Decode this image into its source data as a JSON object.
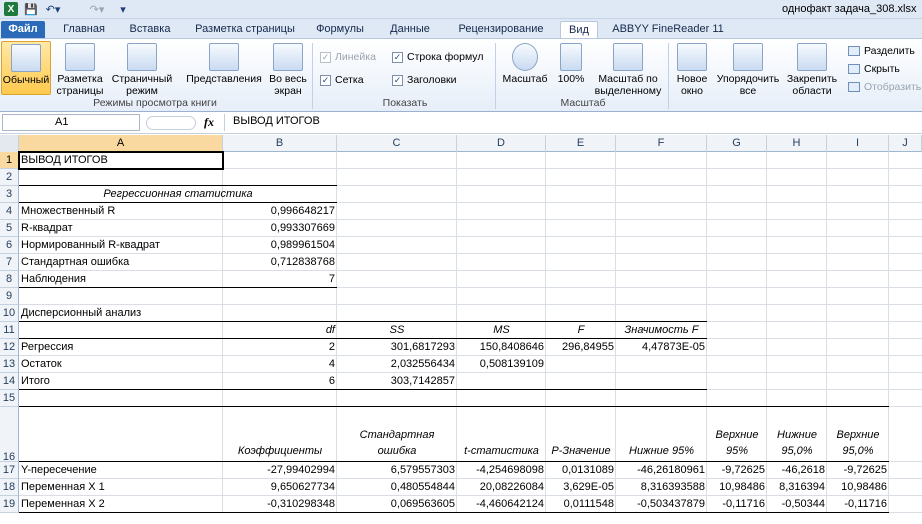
{
  "title_bar": {
    "doc_title": "однофакт задача_308.xlsx"
  },
  "tabs": [
    {
      "label": "Файл"
    },
    {
      "label": "Главная"
    },
    {
      "label": "Вставка"
    },
    {
      "label": "Разметка страницы"
    },
    {
      "label": "Формулы"
    },
    {
      "label": "Данные"
    },
    {
      "label": "Рецензирование"
    },
    {
      "label": "Вид"
    },
    {
      "label": "ABBYY FineReader 11"
    }
  ],
  "ribbon": {
    "views": {
      "normal": "Обычный",
      "page_layout": "Разметка страницы",
      "page_break": "Страничный режим",
      "custom": "Представления",
      "fullscreen": "Во весь экран",
      "group": "Режимы просмотра книги"
    },
    "show": {
      "ruler": "Линейка",
      "formula_bar": "Строка формул",
      "gridlines": "Сетка",
      "headings": "Заголовки",
      "group": "Показать"
    },
    "zoom": {
      "zoom": "Масштаб",
      "hundred": "100%",
      "selection": "Масштаб по выделенному",
      "group": "Масштаб"
    },
    "window": {
      "new": "Новое окно",
      "arrange": "Упорядочить все",
      "freeze": "Закрепить области",
      "split": "Разделить",
      "hide": "Скрыть",
      "unhide": "Отобразить"
    }
  },
  "formula_bar": {
    "name_box": "A1",
    "fx": "fx",
    "formula": "ВЫВОД ИТОГОВ"
  },
  "columns": [
    "A",
    "B",
    "C",
    "D",
    "E",
    "F",
    "G",
    "H",
    "I",
    "J"
  ],
  "rows": [
    "1",
    "2",
    "3",
    "4",
    "5",
    "6",
    "7",
    "8",
    "9",
    "10",
    "11",
    "12",
    "13",
    "14",
    "15",
    "16",
    "17",
    "18",
    "19"
  ],
  "sheet": {
    "r1": {
      "a": "ВЫВОД ИТОГОВ"
    },
    "r3": {
      "a": "Регрессионная статистика"
    },
    "r4": {
      "a": "Множественный R",
      "b": "0,996648217"
    },
    "r5": {
      "a": "R-квадрат",
      "b": "0,993307669"
    },
    "r6": {
      "a": "Нормированный R-квадрат",
      "b": "0,989961504"
    },
    "r7": {
      "a": "Стандартная ошибка",
      "b": "0,712838768"
    },
    "r8": {
      "a": "Наблюдения",
      "b": "7"
    },
    "r10": {
      "a": "Дисперсионный анализ"
    },
    "r11": {
      "b": "df",
      "c": "SS",
      "d": "MS",
      "e": "F",
      "f": "Значимость F"
    },
    "r12": {
      "a": "Регрессия",
      "b": "2",
      "c": "301,6817293",
      "d": "150,8408646",
      "e": "296,84955",
      "f": "4,47873E-05"
    },
    "r13": {
      "a": "Остаток",
      "b": "4",
      "c": "2,032556434",
      "d": "0,508139109"
    },
    "r14": {
      "a": "Итого",
      "b": "6",
      "c": "303,7142857"
    },
    "r16": {
      "b": "Коэффициенты",
      "c": "Стандартная ошибка",
      "d": "t-статистика",
      "e": "P-Значение",
      "f": "Нижние 95%",
      "g": "Верхние 95%",
      "h": "Нижние 95,0%",
      "i": "Верхние 95,0%"
    },
    "r17": {
      "a": "Y-пересечение",
      "b": "-27,99402994",
      "c": "6,579557303",
      "d": "-4,254698098",
      "e": "0,0131089",
      "f": "-46,26180961",
      "g": "-9,72625",
      "h": "-46,2618",
      "i": "-9,72625"
    },
    "r18": {
      "a": "Переменная X 1",
      "b": "9,650627734",
      "c": "0,480554844",
      "d": "20,08226084",
      "e": "3,629E-05",
      "f": "8,316393588",
      "g": "10,98486",
      "h": "8,316394",
      "i": "10,98486"
    },
    "r19": {
      "a": "Переменная X 2",
      "b": "-0,310298348",
      "c": "0,069563605",
      "d": "-4,460642124",
      "e": "0,0111548",
      "f": "-0,503437879",
      "g": "-0,11716",
      "h": "-0,50344",
      "i": "-0,11716"
    }
  }
}
